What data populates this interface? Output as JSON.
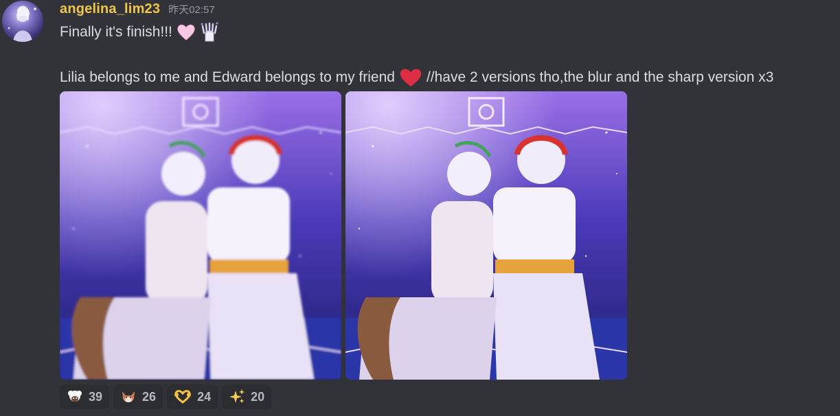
{
  "message": {
    "author": {
      "username": "angelina_lim23",
      "name_color": "#f0c74a"
    },
    "timestamp": "昨天02:57",
    "line1": "Finally it's finish!!!",
    "line1_emojis": [
      "pink-heart-icon",
      "raised-hands-sparkle-icon"
    ],
    "line2_before_emoji": "Lilia belongs to me and Edward belongs to my friend",
    "line2_emoji": "red-heart-icon",
    "line2_after_emoji": "//have 2 versions tho,the blur and the sharp version x3",
    "attachments": [
      {
        "version": "blur"
      },
      {
        "version": "sharp"
      }
    ],
    "reactions": [
      {
        "emoji": "sheep-face-icon",
        "count": "39"
      },
      {
        "emoji": "fox-blush-icon",
        "count": "26"
      },
      {
        "emoji": "heart-hands-icon",
        "count": "24"
      },
      {
        "emoji": "sparkles-icon",
        "count": "20"
      }
    ]
  }
}
